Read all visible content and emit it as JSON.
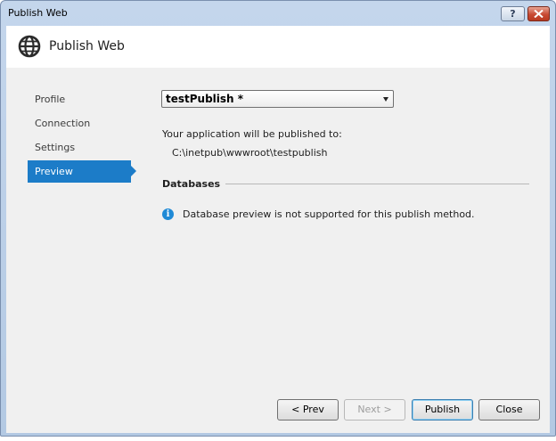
{
  "window": {
    "title": "Publish Web"
  },
  "caption_buttons": {
    "help": "?",
    "close": "✕"
  },
  "header": {
    "title": "Publish Web",
    "icon": "globe-icon"
  },
  "nav": {
    "items": [
      {
        "label": "Profile",
        "active": false
      },
      {
        "label": "Connection",
        "active": false
      },
      {
        "label": "Settings",
        "active": false
      },
      {
        "label": "Preview",
        "active": true
      }
    ]
  },
  "profile_select": {
    "value": "testPublish *"
  },
  "publish_target": {
    "label": "Your application will be published to:",
    "path": "C:\\inetpub\\wwwroot\\testpublish"
  },
  "databases": {
    "title": "Databases",
    "info": "Database preview is not supported for this publish method.",
    "info_icon": "info-icon"
  },
  "buttons": {
    "prev": "< Prev",
    "next": "Next >",
    "publish": "Publish",
    "close": "Close"
  },
  "colors": {
    "accent": "#1c7cc8",
    "info": "#1f8ad6"
  }
}
